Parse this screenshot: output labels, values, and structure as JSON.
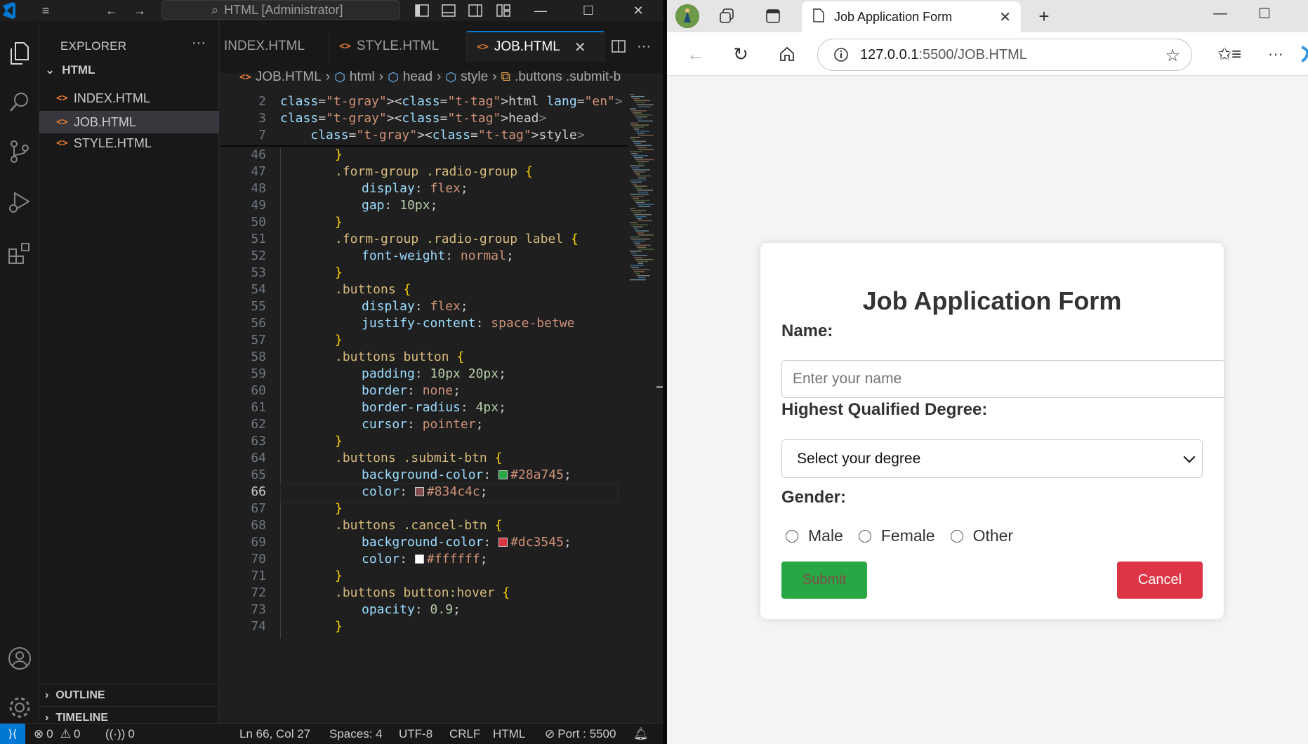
{
  "vscode": {
    "title_search": "HTML [Administrator]",
    "explorer": {
      "title": "EXPLORER",
      "folder": "HTML",
      "files": [
        {
          "name": "INDEX.HTML",
          "active": false
        },
        {
          "name": "JOB.HTML",
          "active": true
        },
        {
          "name": "STYLE.HTML",
          "active": false
        }
      ],
      "outline": "OUTLINE",
      "timeline": "TIMELINE"
    },
    "tabs": [
      {
        "label": "INDEX.HTML"
      },
      {
        "label": "STYLE.HTML"
      },
      {
        "label": "JOB.HTML"
      }
    ],
    "breadcrumb": [
      "JOB.HTML",
      "html",
      "head",
      "style",
      ".buttons .submit-b"
    ],
    "sticky_lines": [
      {
        "n": "2",
        "text": "<html lang=\"en\">"
      },
      {
        "n": "3",
        "text": "<head>"
      },
      {
        "n": "7",
        "text": "    <style>"
      }
    ],
    "code_lines": [
      {
        "n": "46",
        "text": "}"
      },
      {
        "n": "47",
        "text": ".form-group .radio-group {"
      },
      {
        "n": "48",
        "text": "display: flex;"
      },
      {
        "n": "49",
        "text": "gap: 10px;"
      },
      {
        "n": "50",
        "text": "}"
      },
      {
        "n": "51",
        "text": ".form-group .radio-group label {"
      },
      {
        "n": "52",
        "text": "font-weight: normal;"
      },
      {
        "n": "53",
        "text": "}"
      },
      {
        "n": "54",
        "text": ".buttons {"
      },
      {
        "n": "55",
        "text": "display: flex;"
      },
      {
        "n": "56",
        "text": "justify-content: space-betwe"
      },
      {
        "n": "57",
        "text": "}"
      },
      {
        "n": "58",
        "text": ".buttons button {"
      },
      {
        "n": "59",
        "text": "padding: 10px 20px;"
      },
      {
        "n": "60",
        "text": "border: none;"
      },
      {
        "n": "61",
        "text": "border-radius: 4px;"
      },
      {
        "n": "62",
        "text": "cursor: pointer;"
      },
      {
        "n": "63",
        "text": "}"
      },
      {
        "n": "64",
        "text": ".buttons .submit-btn {"
      },
      {
        "n": "65",
        "text": "background-color: #28a745;"
      },
      {
        "n": "66",
        "text": "color: #834c4c;"
      },
      {
        "n": "67",
        "text": "}"
      },
      {
        "n": "68",
        "text": ".buttons .cancel-btn {"
      },
      {
        "n": "69",
        "text": "background-color: #dc3545;"
      },
      {
        "n": "70",
        "text": "color: #ffffff;"
      },
      {
        "n": "71",
        "text": "}"
      },
      {
        "n": "72",
        "text": ".buttons button:hover {"
      },
      {
        "n": "73",
        "text": "opacity: 0.9;"
      },
      {
        "n": "74",
        "text": "}"
      }
    ],
    "status": {
      "errors": "0",
      "warnings": "0",
      "ports": "0",
      "position": "Ln 66, Col 27",
      "spaces": "Spaces: 4",
      "encoding": "UTF-8",
      "eol": "CRLF",
      "language": "HTML",
      "port": "Port : 5500"
    },
    "colors": {
      "submit_bg": "#28a745",
      "submit_color": "#834c4c",
      "cancel_bg": "#dc3545",
      "cancel_color": "#ffffff",
      "accent": "#0078d4"
    }
  },
  "browser": {
    "tab_title": "Job Application Form",
    "url_host": "127.0.0.1",
    "url_path": ":5500/JOB.HTML",
    "form": {
      "title": "Job Application Form",
      "name_label": "Name:",
      "name_placeholder": "Enter your name",
      "degree_label": "Highest Qualified Degree:",
      "degree_selected": "Select your degree",
      "gender_label": "Gender:",
      "gender_options": [
        "Male",
        "Female",
        "Other"
      ],
      "submit_label": "Submit",
      "cancel_label": "Cancel"
    }
  }
}
